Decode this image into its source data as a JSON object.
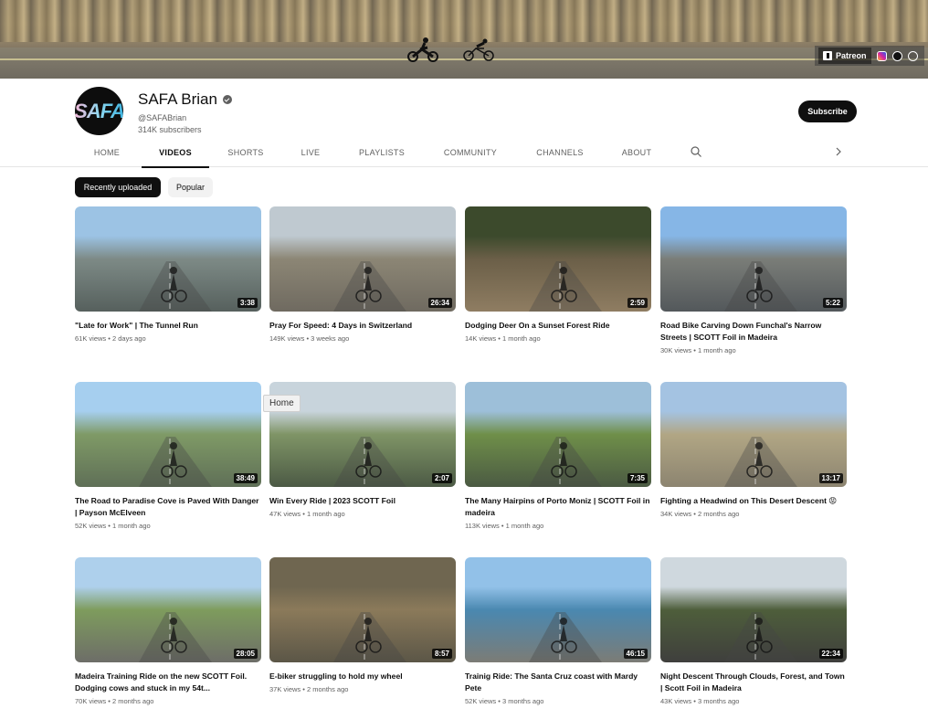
{
  "banner": {
    "links": {
      "patreon_label": "Patreon",
      "icons": [
        "patreon-icon",
        "instagram-icon",
        "strava-icon",
        "globe-icon"
      ]
    }
  },
  "channel": {
    "avatar_text": "SAFA",
    "name": "SAFA Brian",
    "handle": "@SAFABrian",
    "subscribers": "314K subscribers",
    "subscribe_label": "Subscribe"
  },
  "tabs": [
    "HOME",
    "VIDEOS",
    "SHORTS",
    "LIVE",
    "PLAYLISTS",
    "COMMUNITY",
    "CHANNELS",
    "ABOUT"
  ],
  "active_tab": "VIDEOS",
  "filters": [
    "Recently uploaded",
    "Popular"
  ],
  "tooltip": "Home",
  "videos": [
    {
      "title": "\"Late for Work\" | The Tunnel Run",
      "views": "61K views",
      "age": "2 days ago",
      "duration": "3:38",
      "colors": [
        "#9cc3e4",
        "#7d8a86",
        "#56605d"
      ]
    },
    {
      "title": "Pray For Speed: 4 Days in Switzerland",
      "views": "149K views",
      "age": "3 weeks ago",
      "duration": "26:34",
      "colors": [
        "#bfc9d0",
        "#8c8675",
        "#6f6a60"
      ]
    },
    {
      "title": "Dodging Deer On a Sunset Forest Ride",
      "views": "14K views",
      "age": "1 month ago",
      "duration": "2:59",
      "colors": [
        "#3c4a2c",
        "#6b5f48",
        "#8f7d62"
      ]
    },
    {
      "title": "Road Bike Carving Down Funchal's Narrow Streets | SCOTT Foil in Madeira",
      "views": "30K views",
      "age": "1 month ago",
      "duration": "5:22",
      "colors": [
        "#86b6e6",
        "#7a7d78",
        "#53585b"
      ]
    },
    {
      "title": "The Road to Paradise Cove is Paved With Danger | Payson McElveen",
      "views": "52K views",
      "age": "1 month ago",
      "duration": "38:49",
      "colors": [
        "#a6cfef",
        "#7f9a66",
        "#5f6f57"
      ]
    },
    {
      "title": "Win Every Ride | 2023 SCOTT Foil",
      "views": "47K views",
      "age": "1 month ago",
      "duration": "2:07",
      "colors": [
        "#c8d4dc",
        "#7f9466",
        "#4c5a45"
      ]
    },
    {
      "title": "The Many Hairpins of Porto Moniz | SCOTT Foil in madeira",
      "views": "113K views",
      "age": "1 month ago",
      "duration": "7:35",
      "colors": [
        "#9dbfd9",
        "#6f8f49",
        "#4b5a43"
      ]
    },
    {
      "title": "Fighting a Headwind on This Desert Descent 😡",
      "views": "34K views",
      "age": "2 months ago",
      "duration": "13:17",
      "colors": [
        "#a4c3e2",
        "#b1a684",
        "#8c8470"
      ]
    },
    {
      "title": "Madeira Training Ride on the new SCOTT Foil. Dodging cows and stuck in my 54t...",
      "views": "70K views",
      "age": "2 months ago",
      "duration": "28:05",
      "colors": [
        "#aed0ec",
        "#7e9c5d",
        "#6d6d68"
      ]
    },
    {
      "title": "E-biker struggling to hold my wheel",
      "views": "37K views",
      "age": "2 months ago",
      "duration": "8:57",
      "colors": [
        "#6f6650",
        "#8b7a5a",
        "#5b5647"
      ]
    },
    {
      "title": "Trainig Ride: The Santa Cruz coast with Mardy Pete",
      "views": "52K views",
      "age": "3 months ago",
      "duration": "46:15",
      "colors": [
        "#92c1e8",
        "#4a88b0",
        "#7c7c76"
      ]
    },
    {
      "title": "Night Descent Through Clouds, Forest, and Town | Scott Foil in Madeira",
      "views": "43K views",
      "age": "3 months ago",
      "duration": "22:34",
      "colors": [
        "#cfd8de",
        "#4e5e3b",
        "#3f3f3d"
      ]
    }
  ]
}
